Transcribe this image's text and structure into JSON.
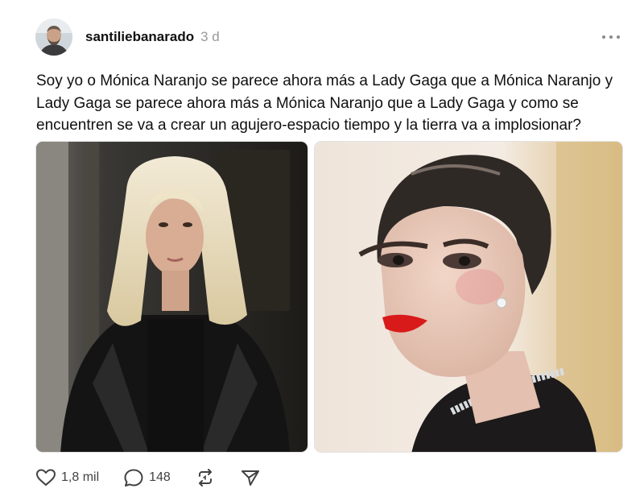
{
  "post": {
    "username": "santiliebanarado",
    "timestamp": "3 d",
    "text": "Soy yo o Mónica Naranjo se parece ahora más a Lady Gaga que a Mónica Naranjo y Lady Gaga se parece ahora más a Mónica Naranjo que a Lady Gaga y como se encuentren se va a crear un agujero-espacio tiempo y la tierra va a implosionar?"
  },
  "icons": {
    "more": "more-horizontal-icon",
    "like": "heart-icon",
    "comment": "comment-bubble-icon",
    "repost": "repost-icon",
    "share": "send-icon"
  },
  "actions": {
    "likes": "1,8 mil",
    "comments": "148"
  },
  "colors": {
    "text": "#101010",
    "muted": "#999999",
    "icon": "#424242",
    "lipstick": "#d81a1a"
  }
}
